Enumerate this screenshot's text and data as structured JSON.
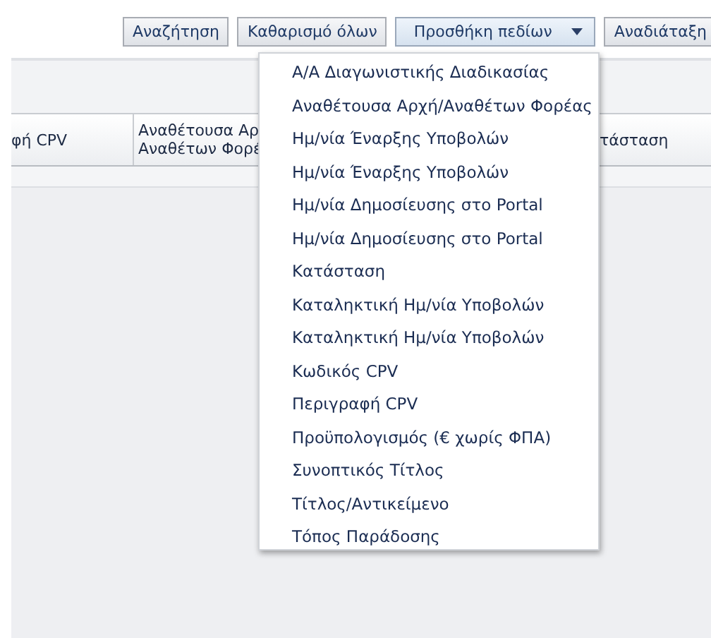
{
  "toolbar": {
    "buttons": [
      {
        "label": "Αναζήτηση",
        "selected": false,
        "dropdown": false
      },
      {
        "label": "Καθαρισμό όλων",
        "selected": false,
        "dropdown": false
      },
      {
        "label": "Προσθήκη πεδίων",
        "selected": true,
        "dropdown": true
      },
      {
        "label": "Αναδιάταξη",
        "selected": false,
        "dropdown": false
      }
    ]
  },
  "table": {
    "columns": [
      "φή CPV",
      "Αναθέτουσα Αρ\nΑναθέτων Φορέ",
      "τάσταση"
    ]
  },
  "menu": {
    "items": [
      "Α/Α Διαγωνιστικής Διαδικασίας",
      "Αναθέτουσα Αρχή/Αναθέτων Φορέας",
      "Ημ/νία Έναρξης Υποβολών",
      "Ημ/νία Έναρξης Υποβολών",
      "Ημ/νία Δημοσίευσης στο Portal",
      "Ημ/νία Δημοσίευσης στο Portal",
      "Κατάσταση",
      "Καταληκτική Ημ/νία Υποβολών",
      "Καταληκτική Ημ/νία Υποβολών",
      "Κωδικός CPV",
      "Περιγραφή CPV",
      "Προϋπολογισμός (€ χωρίς ΦΠΑ)",
      "Συνοπτικός Τίτλος",
      "Τίτλος/Αντικείμενο",
      "Τόπος Παράδοσης"
    ]
  }
}
